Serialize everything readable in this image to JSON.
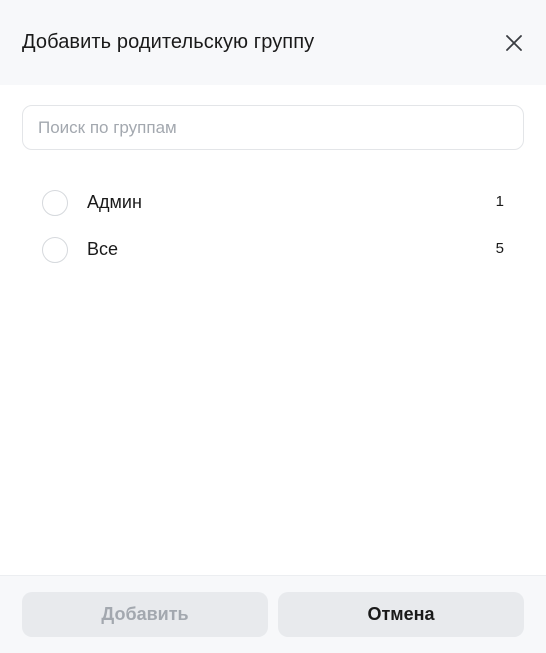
{
  "dialog": {
    "title": "Добавить родительскую группу",
    "close_icon": "close-icon"
  },
  "search": {
    "placeholder": "Поиск по группам",
    "value": ""
  },
  "groups": [
    {
      "label": "Админ",
      "count": "1",
      "selected": false
    },
    {
      "label": "Все",
      "count": "5",
      "selected": false
    }
  ],
  "footer": {
    "add_label": "Добавить",
    "add_disabled": true,
    "cancel_label": "Отмена"
  },
  "colors": {
    "header_bg": "#f7f8fa",
    "button_bg": "#e8eaed",
    "disabled_text": "#a3a8af",
    "text": "#1a1a1a"
  }
}
